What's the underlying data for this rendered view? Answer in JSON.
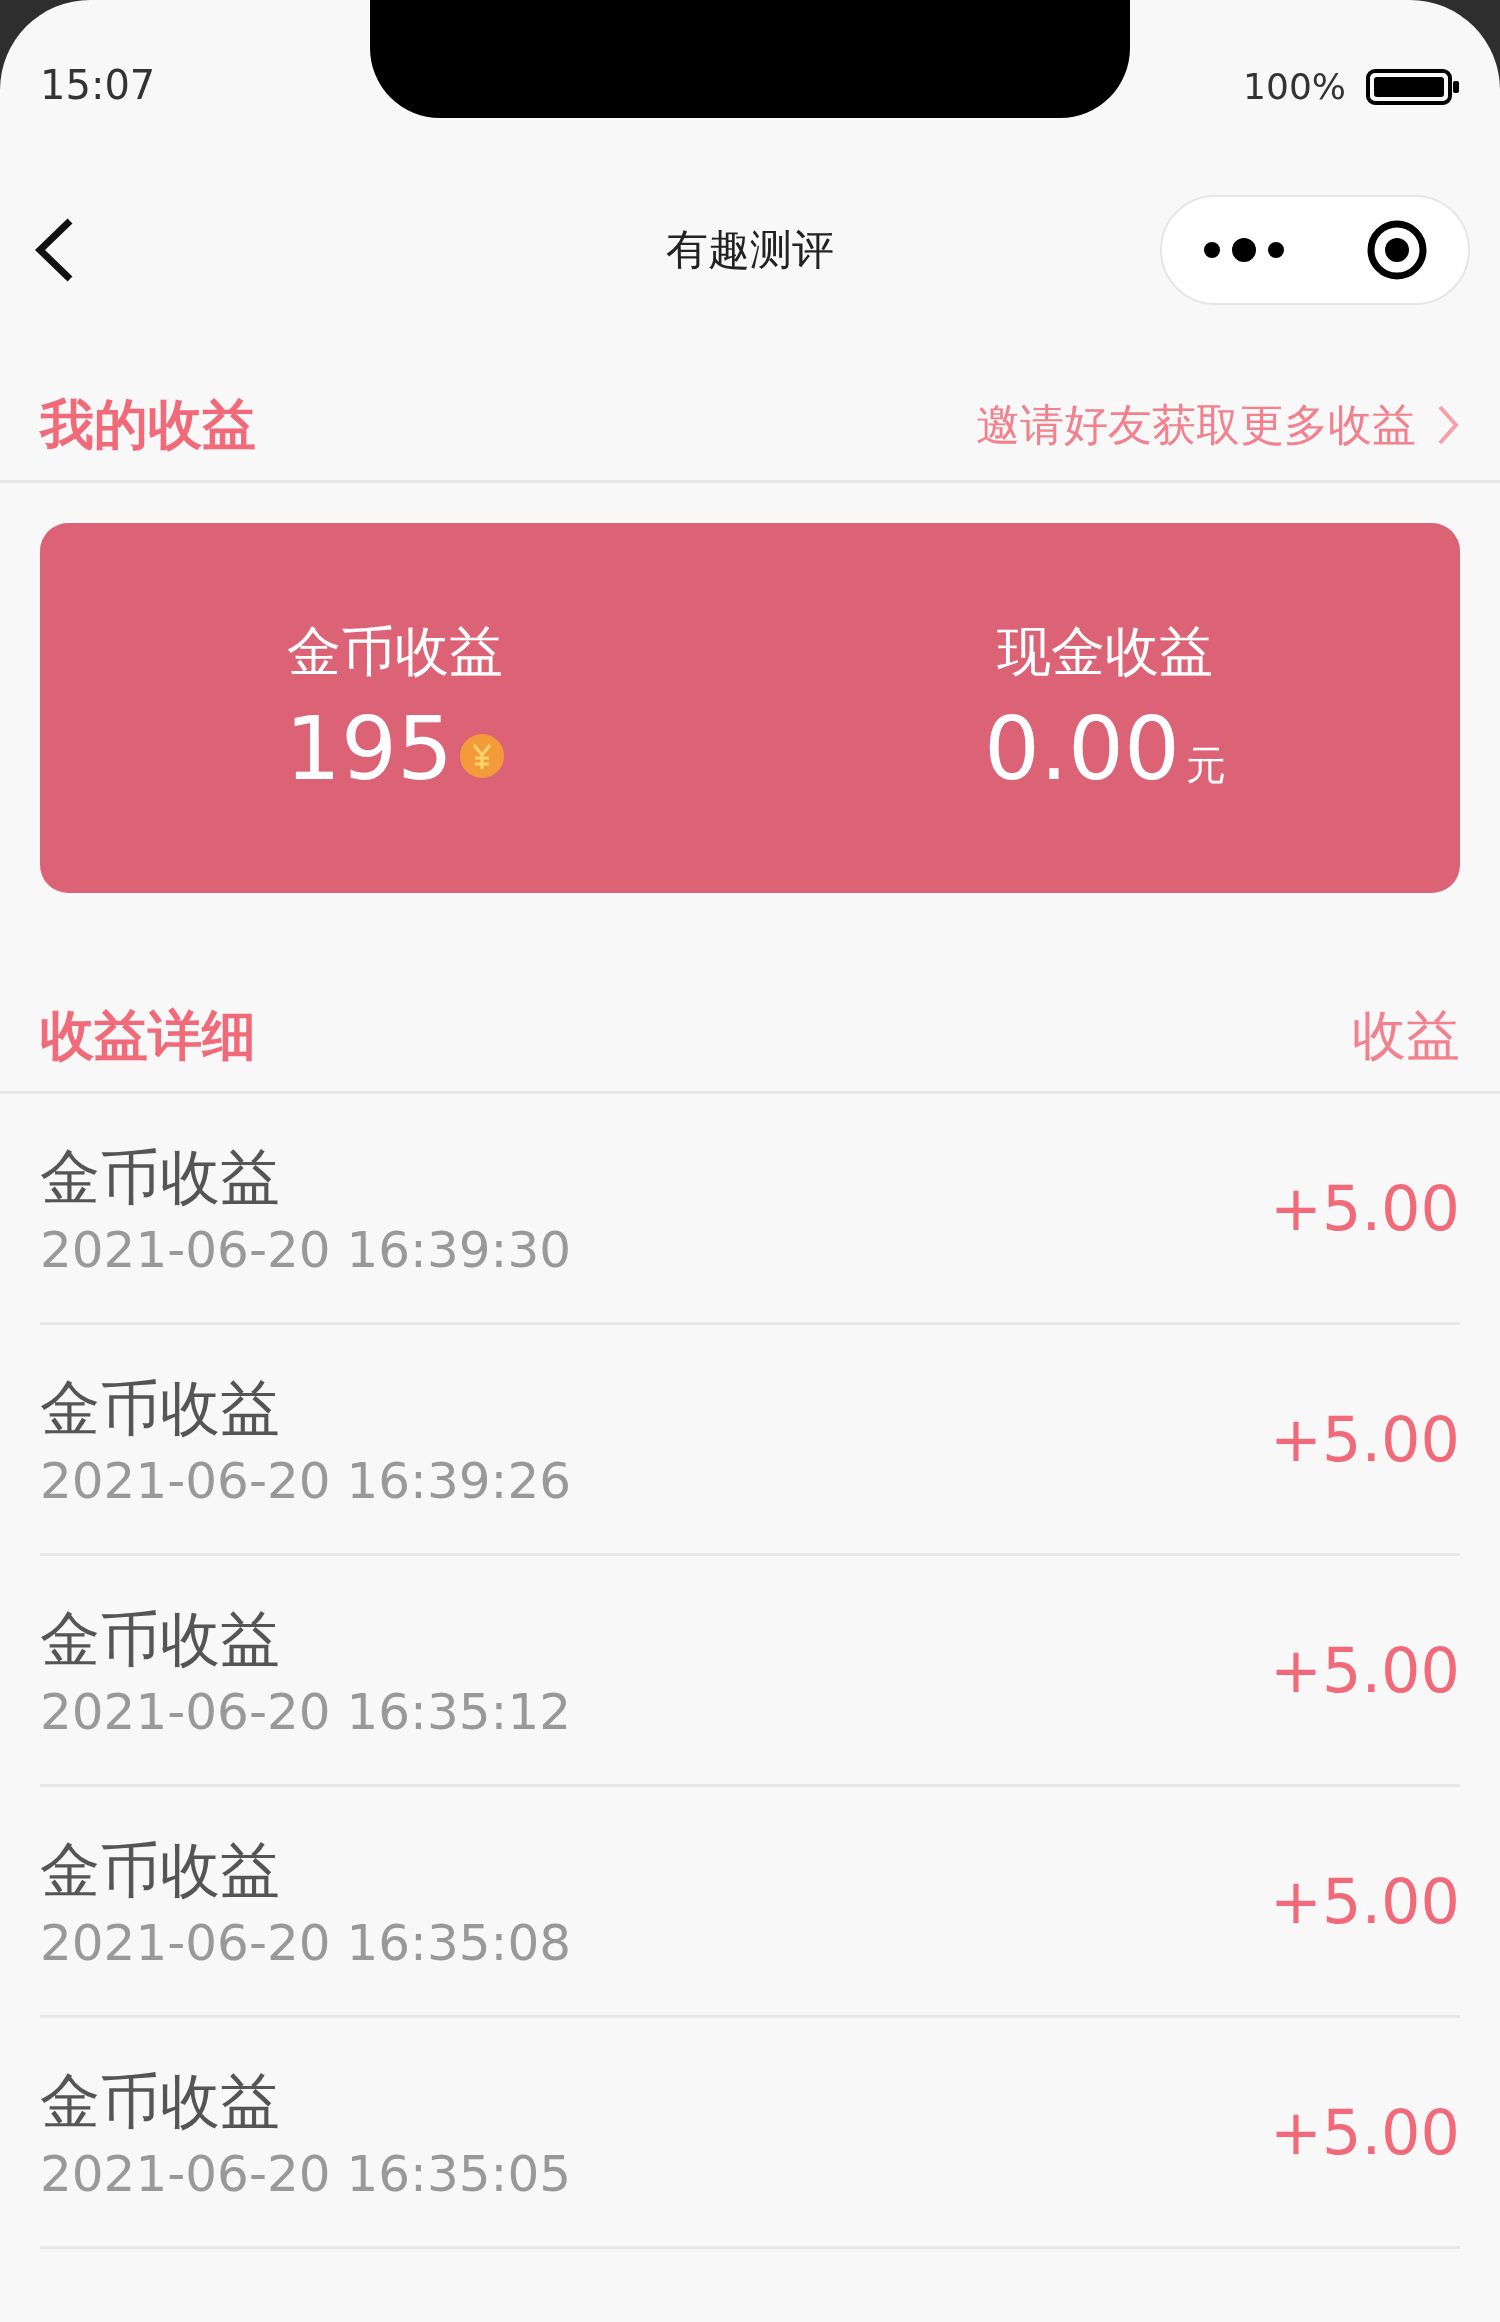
{
  "status_bar": {
    "time": "15:07",
    "battery_text": "100%"
  },
  "nav": {
    "title": "有趣测评"
  },
  "summary_header": {
    "title": "我的收益",
    "link": "邀请好友获取更多收益"
  },
  "summary_card": {
    "items": [
      {
        "kind": "coin",
        "label": "金币收益",
        "value": "195"
      },
      {
        "kind": "cash",
        "label": "现金收益",
        "value": "0.00",
        "unit": "元"
      }
    ]
  },
  "details_header": {
    "title": "收益详细",
    "column": "收益"
  },
  "records": [
    {
      "title": "金币收益",
      "time": "2021-06-20 16:39:30",
      "amount": "+5.00"
    },
    {
      "title": "金币收益",
      "time": "2021-06-20 16:39:26",
      "amount": "+5.00"
    },
    {
      "title": "金币收益",
      "time": "2021-06-20 16:35:12",
      "amount": "+5.00"
    },
    {
      "title": "金币收益",
      "time": "2021-06-20 16:35:08",
      "amount": "+5.00"
    },
    {
      "title": "金币收益",
      "time": "2021-06-20 16:35:05",
      "amount": "+5.00"
    }
  ]
}
